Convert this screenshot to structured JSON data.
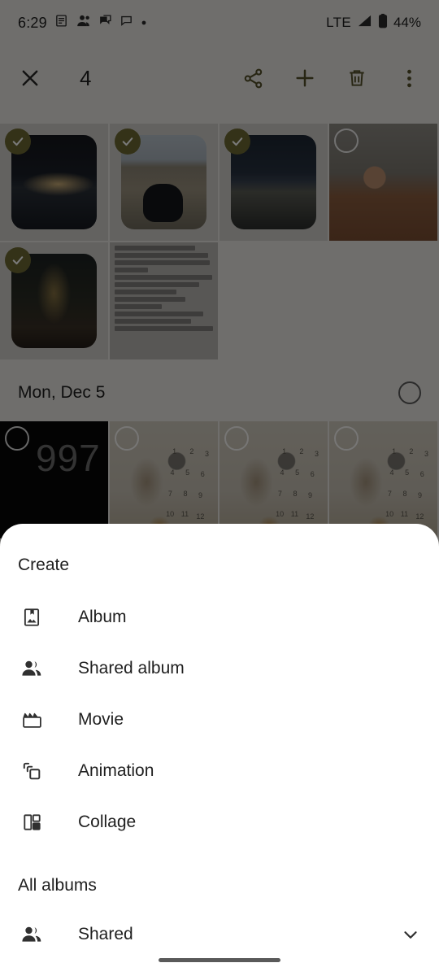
{
  "status_bar": {
    "time": "6:29",
    "network": "LTE",
    "battery_percent": "44%",
    "icons": [
      "calendar-icon",
      "people-icon",
      "chat-bubbles-icon",
      "message-icon",
      "dot-icon",
      "signal-icon",
      "battery-icon"
    ]
  },
  "selection_toolbar": {
    "close_label": "close-icon",
    "selected_count": "4",
    "actions": [
      {
        "name": "share-icon"
      },
      {
        "name": "add-icon"
      },
      {
        "name": "delete-icon"
      },
      {
        "name": "more-options-icon"
      }
    ]
  },
  "photo_grid": {
    "date_header": {
      "label": "Mon, Dec 5"
    },
    "rows": [
      {
        "cells": [
          {
            "art": "pier",
            "selected": true,
            "label": "photo-night-pier"
          },
          {
            "art": "beach",
            "selected": true,
            "label": "photo-beach-feet"
          },
          {
            "art": "bay",
            "selected": true,
            "label": "photo-bay-dusk"
          },
          {
            "art": "kid",
            "selected": false,
            "label": "photo-child-table"
          }
        ]
      },
      {
        "cells": [
          {
            "art": "tree",
            "selected": true,
            "label": "photo-christmas-tree"
          },
          {
            "art": "doc",
            "selected": false,
            "label": "photo-text-screenshot"
          }
        ]
      }
    ],
    "second_section_rows": [
      {
        "cells": [
          {
            "art": "black",
            "selected": false,
            "label": "photo-video-997",
            "overlay_text": "997"
          },
          {
            "art": "baby",
            "selected": false,
            "label": "photo-baby-milestone-1"
          },
          {
            "art": "baby",
            "selected": false,
            "label": "photo-baby-milestone-2"
          },
          {
            "art": "baby",
            "selected": false,
            "label": "photo-baby-milestone-3"
          }
        ]
      }
    ],
    "screenshot_text_lines": [
      "minutes to the venue",
      "Pick-up/Important Location:",
      "Main Entrance, Sofitel The",
      "Palm",
      "Drop-off location: Conference",
      "Center, Atlantis the Palm",
      "Venue is  Hotel",
      "Time: 09:00 – 11:00 am",
      "December 7",
      "Transportation: 5 shuttle",
      "buses, leaving every 10",
      "minutes to return to the hotel"
    ]
  },
  "bottom_sheet": {
    "create_section": {
      "title": "Create",
      "items": [
        {
          "label": "Album",
          "icon": "album-icon"
        },
        {
          "label": "Shared album",
          "icon": "people-icon"
        },
        {
          "label": "Movie",
          "icon": "movie-clapper-icon"
        },
        {
          "label": "Animation",
          "icon": "animation-stack-icon"
        },
        {
          "label": "Collage",
          "icon": "collage-icon"
        }
      ]
    },
    "all_albums_section": {
      "title": "All albums",
      "items": [
        {
          "label": "Shared",
          "icon": "people-icon",
          "trailing_icon": "chevron-down-icon"
        }
      ]
    }
  },
  "nav_bar": {
    "handle": "gesture-handle"
  },
  "colors": {
    "sheet_background": "#ffffff",
    "text_primary": "#1f1f1f",
    "scrim": "rgba(0,0,0,0.52)",
    "selection_badge": "#6e6a33",
    "grid_background": "#e8e6e1",
    "nav_handle": "#5a5a5a"
  }
}
